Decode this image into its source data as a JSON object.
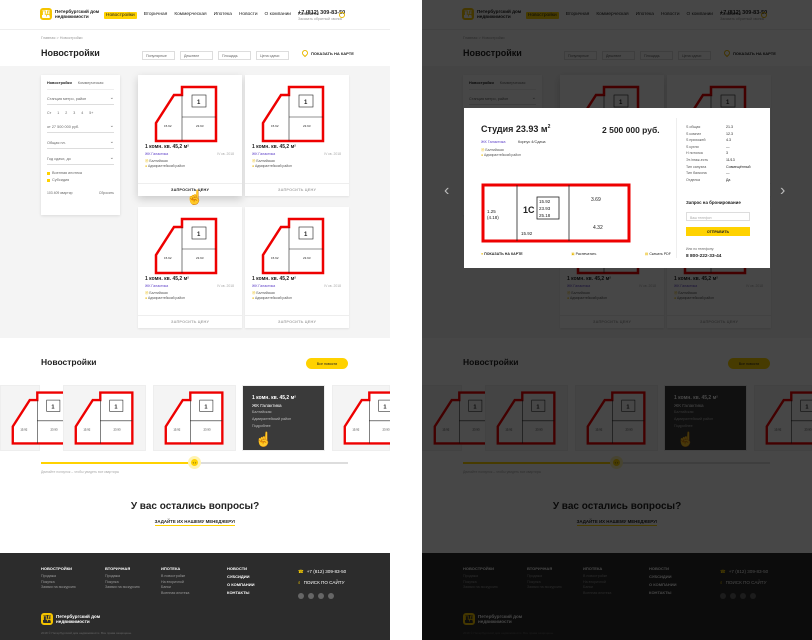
{
  "header": {
    "logo_mark": "ПД",
    "logo_text": "Петербургский дом недвижимости",
    "nav": [
      "Новостройки",
      "Вторичная",
      "Коммерческая",
      "Ипотека",
      "Новости",
      "О компании",
      "Контакты"
    ],
    "phone": "+7 (812) 309-83-50",
    "phone_sub": "Заказать обратный звонок"
  },
  "breadcrumbs": "Главная > Новостройки",
  "page_title": "Новостройки",
  "filters": [
    "Популярные",
    "Дешевле",
    "Площадь",
    "Цена сдачи"
  ],
  "map_button": "ПОКАЗАТЬ НА КАРТЕ",
  "sidebar": {
    "tabs": [
      "Новостройки",
      "Коммерческая"
    ],
    "station": "Станция метро, район",
    "rooms": [
      "Ст",
      "1",
      "2",
      "3",
      "4",
      "5+"
    ],
    "price_from": "от 27 500 000",
    "price_unit": "руб.",
    "area": "Общая пл.",
    "deadline": "Год сдачи, до",
    "checks": [
      "Военная ипотека",
      "Субсидия"
    ],
    "found": "103 409 квартир",
    "reset": "Сбросить"
  },
  "cards": [
    {
      "title": "1 комн. кв. 45,2 м²",
      "project": "ЖК Галактика",
      "date": "IV кв. 2018",
      "metro": "Балтийская",
      "district": "Адмиралтейский район",
      "button": "ЗАПРОСИТЬ ЦЕНУ"
    },
    {
      "title": "1 комн. кв. 45,2 м²",
      "project": "ЖК Галактика",
      "date": "IV кв. 2018",
      "metro": "Балтийская",
      "district": "Адмиралтейский район",
      "button": "ЗАПРОСИТЬ ЦЕНУ"
    },
    {
      "title": "1 комн. кв. 45,2 м²",
      "project": "ЖК Галактика",
      "date": "IV кв. 2018",
      "metro": "Балтийская",
      "district": "Адмиралтейский район",
      "button": "ЗАПРОСИТЬ ЦЕНУ"
    },
    {
      "title": "1 комн. кв. 45,2 м²",
      "project": "ЖК Галактика",
      "date": "IV кв. 2018",
      "metro": "Балтийская",
      "district": "Адмиралтейский район",
      "button": "ЗАПРОСИТЬ ЦЕНУ"
    }
  ],
  "section2": {
    "title": "Новостройки",
    "all_button": "Все новости",
    "hover_title": "1 комн. кв. 45,2 м²",
    "hover_project": "ЖК Галактика",
    "hover_metro": "Балтийская",
    "hover_district": "Адмиралтейский район",
    "hover_link": "Подробнее",
    "slider_hint": "Двигайте ползунок – чтобы увидеть все квартиры",
    "knob": "‹ ›"
  },
  "questions": {
    "title": "У вас остались вопросы?",
    "link": "ЗАДАЙТЕ ИХ НАШЕМУ МЕНЕДЖЕРУ!"
  },
  "footer": {
    "col1": {
      "title": "НОВОСТРОЙКИ",
      "items": [
        "Продажа",
        "Покупка",
        "Заявки на экскурсию"
      ]
    },
    "col2": {
      "title": "ВТОРИЧНАЯ",
      "items": [
        "Продажа",
        "Покупка",
        "Заявки на экскурсию"
      ]
    },
    "col3": {
      "title": "ИПОТЕКА",
      "items": [
        "В новостройке",
        "На вторичной",
        "Банки",
        "Военная ипотека"
      ]
    },
    "col4": {
      "items": [
        "НОВОСТИ",
        "СУБСИДИИ",
        "О КОМПАНИИ",
        "КОНТАКТЫ"
      ]
    },
    "phone": "+7 (812) 309-83-50",
    "search": "ПОИСК ПО САЙТУ",
    "social": [
      "vk",
      "fb",
      "ok",
      "in"
    ],
    "logo_text": "Петербургский дом недвижимости",
    "copyright": "2018 © Петербургский дом недвижимости. Все права защищены."
  },
  "modal": {
    "title": "Студия 23.93 м",
    "title_sup": "2",
    "price": "2 500 000 руб.",
    "project": "ЖК Галактика",
    "building": "Корпус 4/Сдача",
    "metro": "Балтийская",
    "district": "Адмиралтейский район",
    "map": "ПОКАЗАТЬ НА КАРТЕ",
    "print": "Распечатать",
    "pdf": "Скачать PDF",
    "specs": [
      [
        "S общая",
        "21.3"
      ],
      [
        "S комнат",
        "12.3"
      ],
      [
        "S прихожей",
        "4.3"
      ],
      [
        "S кухни",
        "—"
      ],
      [
        "Н потолка",
        "3"
      ],
      [
        "Эт./этаж-есть",
        "11/13"
      ],
      [
        "Тип санузла",
        "Совмещённый"
      ],
      [
        "Тип балкона",
        "—"
      ],
      [
        "Отделка",
        "Да"
      ]
    ],
    "request_title": "Запрос на бронирование",
    "input_placeholder": "Ваш телефон",
    "send": "ОТПРАВИТЬ",
    "or_phone": "Или по телефону:",
    "phone": "8 800-222-33-44"
  },
  "plan_labels": {
    "a": "1",
    "b": "15.92",
    "c": "23.93",
    "d": "25.18",
    "e": "3.69",
    "f": "4.32",
    "g": "1.25",
    "h": "(4.18)",
    "i": "1С"
  }
}
